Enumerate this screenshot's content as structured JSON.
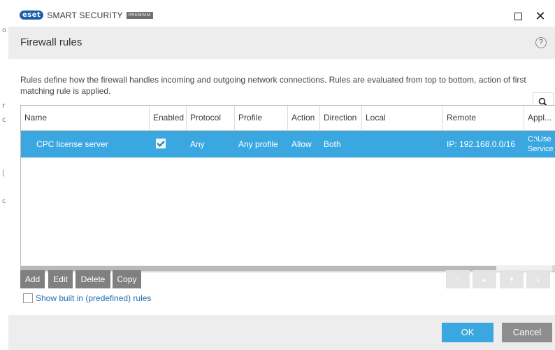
{
  "app": {
    "brand_badge": "eset",
    "product_name": "SMART SECURITY",
    "edition": "PREMIUM"
  },
  "window_controls": {
    "maximize_icon": "square-icon",
    "close_glyph": "✕"
  },
  "header": {
    "title": "Firewall rules",
    "help_glyph": "?"
  },
  "description": "Rules define how the firewall handles incoming and outgoing network connections. Rules are evaluated from top to bottom, action of first matching rule is applied.",
  "table": {
    "columns": [
      "Name",
      "Enabled",
      "Protocol",
      "Profile",
      "Action",
      "Direction",
      "Local",
      "Remote",
      "Appl..."
    ],
    "rows": [
      {
        "name": "CPC license server",
        "enabled": true,
        "protocol": "Any",
        "profile": "Any profile",
        "action": "Allow",
        "direction": "Both",
        "local": "",
        "remote": "IP: 192.168.0.0/16",
        "application_line1": "C:\\Use",
        "application_line2": "Service"
      }
    ]
  },
  "buttons": {
    "add": "Add",
    "edit": "Edit",
    "delete": "Delete",
    "copy": "Copy",
    "ok": "OK",
    "cancel": "Cancel"
  },
  "show_builtin": {
    "label": "Show built in (predefined) rules",
    "checked": false
  },
  "colors": {
    "accent": "#3aa7e0",
    "header_bg": "#ededed",
    "button_gray": "#808080",
    "link_blue": "#1f6fb2"
  }
}
